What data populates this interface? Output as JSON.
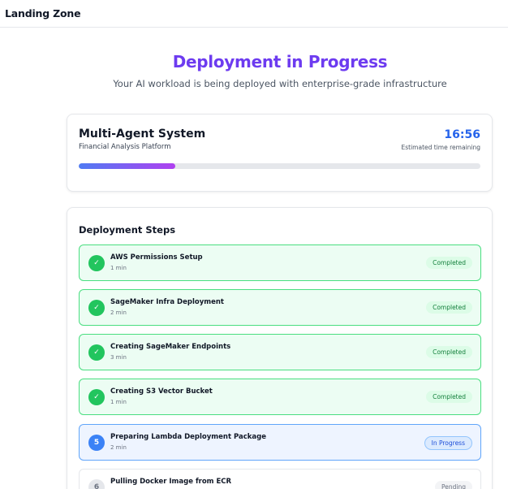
{
  "app": {
    "brand": "Landing Zone"
  },
  "header": {
    "title": "Deployment in Progress",
    "subtitle": "Your AI workload is being deployed with enterprise-grade infrastructure"
  },
  "summary": {
    "system_name": "Multi-Agent System",
    "platform": "Financial Analysis Platform",
    "time_remaining": "16:56",
    "time_label": "Estimated time remaining",
    "progress_percent": 24
  },
  "steps": {
    "title": "Deployment Steps",
    "items": [
      {
        "icon": "check-icon",
        "marker": "✓",
        "name": "AWS Permissions Setup",
        "duration": "1 min",
        "status": "Completed"
      },
      {
        "icon": "check-icon",
        "marker": "✓",
        "name": "SageMaker Infra Deployment",
        "duration": "2 min",
        "status": "Completed"
      },
      {
        "icon": "check-icon",
        "marker": "✓",
        "name": "Creating SageMaker Endpoints",
        "duration": "3 min",
        "status": "Completed"
      },
      {
        "icon": "check-icon",
        "marker": "✓",
        "name": "Creating S3 Vector Bucket",
        "duration": "1 min",
        "status": "Completed"
      },
      {
        "icon": "step-number-icon",
        "marker": "5",
        "name": "Preparing Lambda Deployment Package",
        "duration": "2 min",
        "status": "In Progress"
      },
      {
        "icon": "step-number-icon",
        "marker": "6",
        "name": "Pulling Docker Image from ECR",
        "duration": "",
        "status": "Pending"
      }
    ]
  },
  "colors": {
    "accent": "#6d3bf0",
    "timer": "#2563eb",
    "completed": "#22c55e",
    "in_progress": "#3b82f6"
  }
}
